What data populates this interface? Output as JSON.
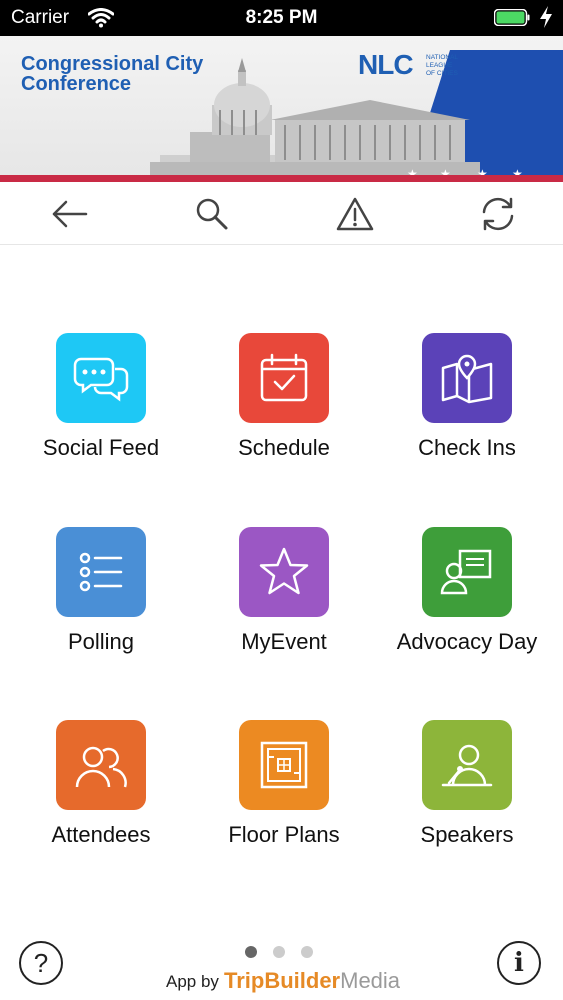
{
  "status_bar": {
    "carrier": "Carrier",
    "time": "8:25 PM"
  },
  "banner": {
    "title_line1": "Congressional City",
    "title_line2": "Conference",
    "logo_text": "NLC",
    "logo_sub1": "NATIONAL",
    "logo_sub2": "LEAGUE",
    "logo_sub3": "OF CITIES"
  },
  "toolbar": {
    "buttons": [
      {
        "name": "back",
        "icon": "arrow-left-icon"
      },
      {
        "name": "search",
        "icon": "search-icon"
      },
      {
        "name": "alert",
        "icon": "warning-icon"
      },
      {
        "name": "refresh",
        "icon": "refresh-icon"
      }
    ]
  },
  "tiles": [
    {
      "label": "Social Feed",
      "color": "#1ec8f5",
      "icon": "chat-bubbles-icon"
    },
    {
      "label": "Schedule",
      "color": "#e8483a",
      "icon": "calendar-check-icon"
    },
    {
      "label": "Check Ins",
      "color": "#5b42b8",
      "icon": "map-pin-icon"
    },
    {
      "label": "Polling",
      "color": "#4a8fd6",
      "icon": "list-icon"
    },
    {
      "label": "MyEvent",
      "color": "#9b57c4",
      "icon": "star-icon"
    },
    {
      "label": "Advocacy Day",
      "color": "#3e9e3a",
      "icon": "presenter-icon"
    },
    {
      "label": "Attendees",
      "color": "#e66a2c",
      "icon": "people-icon"
    },
    {
      "label": "Floor Plans",
      "color": "#ec8a22",
      "icon": "floor-plan-icon"
    },
    {
      "label": "Speakers",
      "color": "#8db53a",
      "icon": "speaker-podium-icon"
    }
  ],
  "bottom": {
    "help_glyph": "?",
    "info_glyph": "i",
    "app_by": "App by",
    "brand_part1": "TripBuilder",
    "brand_part2": "Media",
    "page_count": 3,
    "current_page": 1
  }
}
